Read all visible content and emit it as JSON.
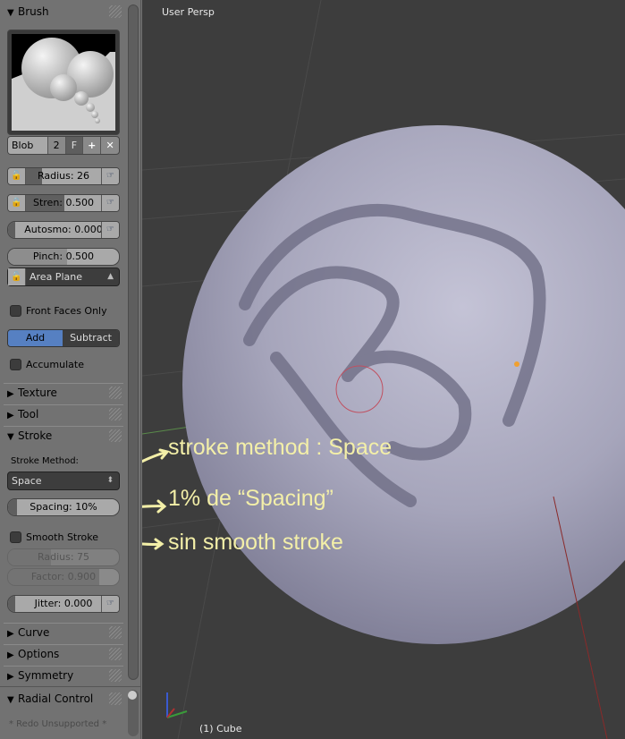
{
  "panel": {
    "brush": {
      "header": "Brush",
      "name": "Blob",
      "users": "2",
      "fake_user": "F",
      "add_icon": "plus-icon",
      "delete_icon": "x-icon"
    },
    "radius": {
      "label": "Radius: 26",
      "fraction": 0.15
    },
    "strength": {
      "label": "Stren: 0.500",
      "fraction": 0.5
    },
    "autosmooth": {
      "label": "Autosmo: 0.000",
      "fraction": 0.0
    },
    "pinch": {
      "label": "Pinch: 0.500",
      "fraction": 0.5
    },
    "plane": "Area Plane",
    "front_faces": "Front Faces Only",
    "add": "Add",
    "subtract": "Subtract",
    "accumulate": "Accumulate",
    "texture": "Texture",
    "tool": "Tool",
    "stroke": "Stroke",
    "stroke_method_label": "Stroke Method:",
    "stroke_method": "Space",
    "spacing": {
      "label": "Spacing: 10%",
      "fraction": 0.1
    },
    "smooth_stroke": "Smooth Stroke",
    "smooth_radius": {
      "label": "Radius: 75",
      "fraction": 0.4
    },
    "smooth_factor": {
      "label": "Factor: 0.900",
      "fraction": 0.9
    },
    "jitter": {
      "label": "Jitter: 0.000",
      "fraction": 0.0
    },
    "curve": "Curve",
    "options": "Options",
    "symmetry": "Symmetry",
    "radial_control": "Radial Control",
    "redo": "* Redo Unsupported *"
  },
  "viewport": {
    "view_name": "User Persp",
    "object": "(1) Cube"
  },
  "annotations": {
    "a1": "stroke method : Space",
    "a2": "1% de “Spacing”",
    "a3": "sin smooth stroke",
    "color": "#f3efa8"
  }
}
